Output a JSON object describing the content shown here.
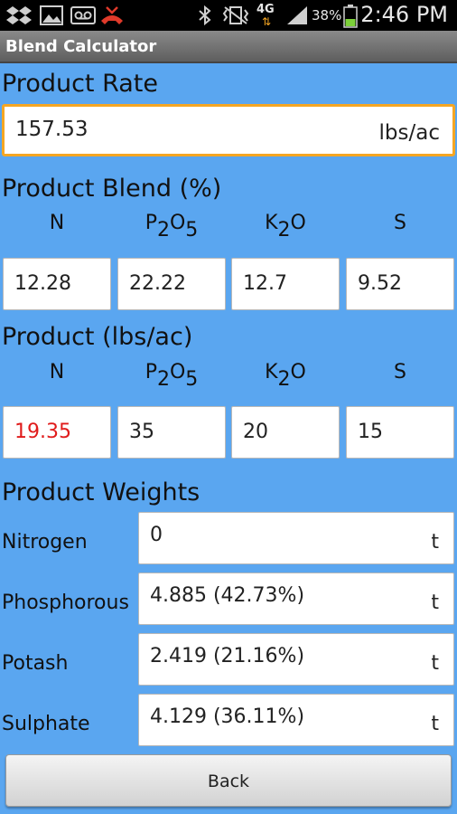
{
  "status_bar": {
    "battery": "38%",
    "network": "4G",
    "time": "2:46 PM",
    "icons": [
      "dropbox-icon",
      "gallery-icon",
      "voicemail-icon",
      "missed-call-icon",
      "bluetooth-icon",
      "vibrate-icon",
      "signal-icon",
      "battery-icon"
    ]
  },
  "app": {
    "title": "Blend Calculator"
  },
  "product_rate": {
    "heading": "Product Rate",
    "value": "157.53",
    "unit": "lbs/ac"
  },
  "product_blend": {
    "heading": "Product Blend (%)",
    "headers": [
      {
        "base": "N",
        "sub1": "",
        "mid": "",
        "sub2": ""
      },
      {
        "base": "P",
        "sub1": "2",
        "mid": "O",
        "sub2": "5"
      },
      {
        "base": "K",
        "sub1": "2",
        "mid": "O",
        "sub2": ""
      },
      {
        "base": "S",
        "sub1": "",
        "mid": "",
        "sub2": ""
      }
    ],
    "values": [
      "12.28",
      "22.22",
      "12.7",
      "9.52"
    ]
  },
  "product_lbs": {
    "heading": "Product (lbs/ac)",
    "values": [
      "19.35",
      "35",
      "20",
      "15"
    ],
    "highlight_color": "#e01b1b"
  },
  "product_weights": {
    "heading": "Product Weights",
    "rows": [
      {
        "label": "Nitrogen",
        "value": "0",
        "unit": "t"
      },
      {
        "label": "Phosphorous",
        "value": "4.885 (42.73%)",
        "unit": "t"
      },
      {
        "label": "Potash",
        "value": "2.419 (21.16%)",
        "unit": "t"
      },
      {
        "label": "Sulphate",
        "value": "4.129 (36.11%)",
        "unit": "t"
      }
    ]
  },
  "buttons": {
    "back": "Back"
  },
  "colors": {
    "background": "#5aa6f0",
    "focus_border": "#f5a623",
    "title_bar": "#707070"
  }
}
